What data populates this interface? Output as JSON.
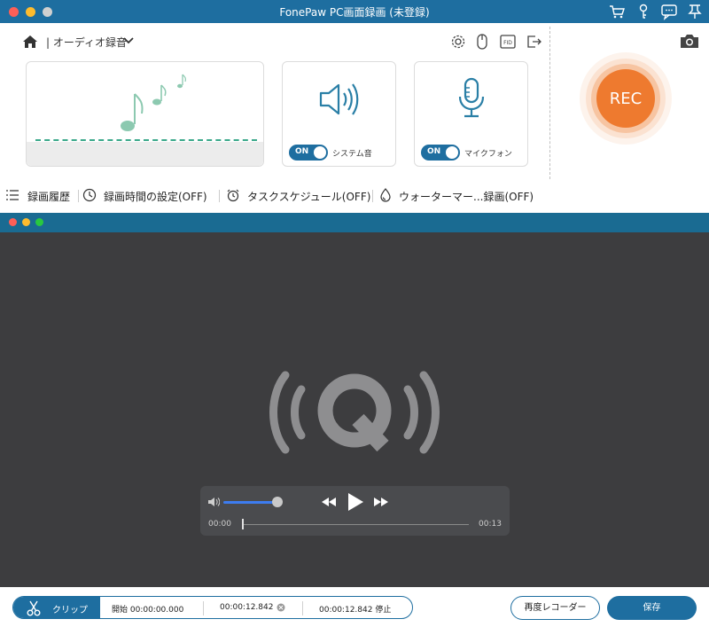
{
  "window": {
    "title": "FonePaw PC画面録画 (未登録)"
  },
  "header": {
    "mode_label": "| オーディオ録音"
  },
  "cards": {
    "system_sound": {
      "toggle": "ON",
      "label": "システム音"
    },
    "microphone": {
      "toggle": "ON",
      "label": "マイクフォン"
    }
  },
  "rec_button": {
    "label": "REC"
  },
  "bottom_bar": {
    "history": "録画履歴",
    "record_time": "録画時間の設定(OFF)",
    "task_schedule": "タスクスケジュール(OFF)",
    "watermark": "ウォーターマー...録画(OFF)"
  },
  "player": {
    "current_time": "00:00",
    "total_time": "00:13",
    "volume_fraction": 1.0,
    "progress_fraction": 0.0
  },
  "clipbar": {
    "clip_label": "クリップ",
    "start": "開始  00:00:00.000",
    "middle": "00:00:12.842",
    "end": "00:00:12.842  停止",
    "recorder_again": "再度レコーダー",
    "save": "保存"
  },
  "colors": {
    "accent": "#1e6ea0",
    "rec": "#ee7a2f",
    "note": "#8cc9b0",
    "icon_blue": "#2a7fa6"
  }
}
